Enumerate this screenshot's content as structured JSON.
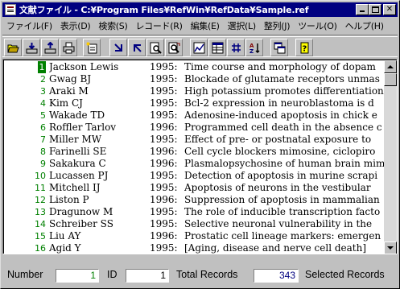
{
  "window": {
    "title": "文献ファイル - C:¥Program Files¥RefWin¥RefData¥Sample.ref"
  },
  "menu": [
    "ファイル(F)",
    "表示(D)",
    "検索(S)",
    "レコード(R)",
    "編集(E)",
    "選択(L)",
    "整列(J)",
    "ツール(O)",
    "ヘルプ(H)"
  ],
  "toolbar": [
    "open-folder-icon",
    "import-icon",
    "export-icon",
    "print-icon",
    "new-record-icon",
    "arrow-down-left-icon",
    "arrow-up-right-icon",
    "search-page-icon",
    "search-page-next-icon",
    "chart-icon",
    "table-icon",
    "sort-hash-icon",
    "sort-az-icon",
    "windows-icon",
    "help-icon"
  ],
  "colors": {
    "title_bar": "#000080",
    "record_number": "#008000",
    "selected_number_bg": "#008000"
  },
  "records": [
    {
      "num": "1",
      "author": "Jackson Lewis",
      "year": "1995:",
      "title": "Time course and morphology of dopam"
    },
    {
      "num": "2",
      "author": "Gwag BJ",
      "year": "1995:",
      "title": "Blockade of glutamate receptors unmas"
    },
    {
      "num": "3",
      "author": "Araki M",
      "year": "1995:",
      "title": "High potassium promotes differentiation"
    },
    {
      "num": "4",
      "author": "Kim CJ",
      "year": "1995:",
      "title": "Bcl-2 expression in neuroblastoma is d"
    },
    {
      "num": "5",
      "author": "Wakade TD",
      "year": "1995:",
      "title": "Adenosine-induced apoptosis in chick e"
    },
    {
      "num": "6",
      "author": "Roffler Tarlov",
      "year": "1996:",
      "title": "Programmed cell death in the absence c"
    },
    {
      "num": "7",
      "author": "Miller MW",
      "year": "1995:",
      "title": "Effect of pre- or postnatal exposure to"
    },
    {
      "num": "8",
      "author": "Farinelli SE",
      "year": "1996:",
      "title": "Cell cycle blockers mimosine, ciclopiro"
    },
    {
      "num": "9",
      "author": "Sakakura C",
      "year": "1996:",
      "title": "Plasmalopsychosine of human brain mim"
    },
    {
      "num": "10",
      "author": "Lucassen PJ",
      "year": "1995:",
      "title": "Detection of apoptosis in murine scrapi"
    },
    {
      "num": "11",
      "author": "Mitchell IJ",
      "year": "1995:",
      "title": "Apoptosis of neurons in the vestibular"
    },
    {
      "num": "12",
      "author": "Liston P",
      "year": "1996:",
      "title": "Suppression of apoptosis in mammalian"
    },
    {
      "num": "13",
      "author": "Dragunow M",
      "year": "1995:",
      "title": "The role of inducible transcription facto"
    },
    {
      "num": "14",
      "author": "Schreiber SS",
      "year": "1995:",
      "title": "Selective neuronal vulnerability in the"
    },
    {
      "num": "15",
      "author": "Liu AY",
      "year": "1996:",
      "title": "Prostatic cell lineage markers: emergen"
    },
    {
      "num": "16",
      "author": "Agid Y",
      "year": "1995:",
      "title": "[Aging, disease and nerve cell death]"
    }
  ],
  "status": {
    "number_label": "Number",
    "number_value": "1",
    "id_label": "ID",
    "id_value": "1",
    "total_label": "Total Records",
    "total_value": "343",
    "selected_label": "Selected Records"
  }
}
